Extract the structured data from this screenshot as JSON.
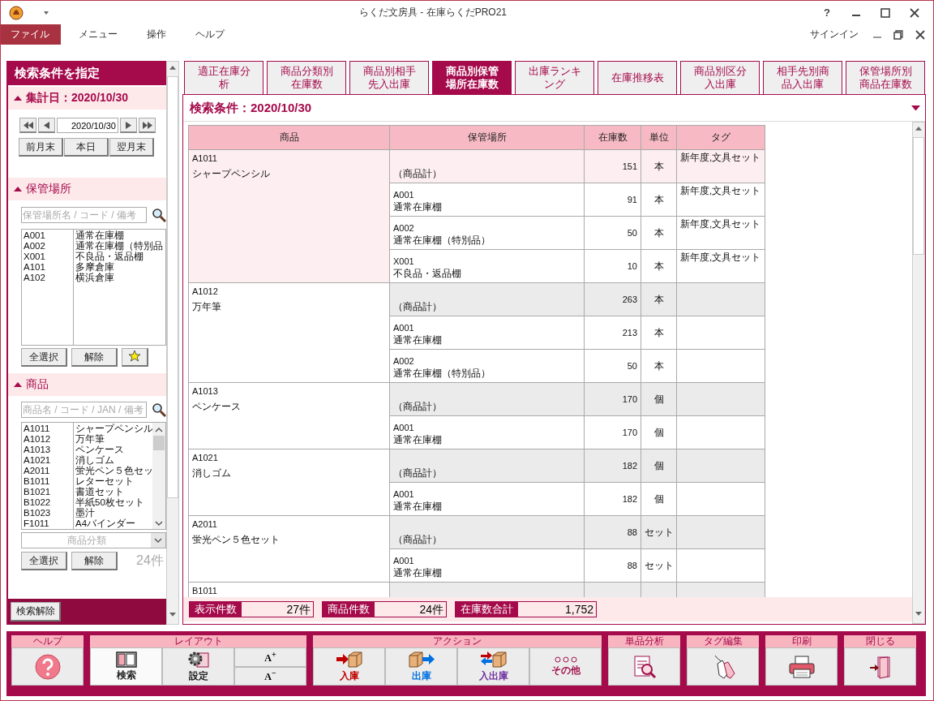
{
  "window": {
    "title": "らくだ文房具 - 在庫らくだPRO21",
    "help": "?"
  },
  "menu": {
    "items": [
      {
        "label": "ファイル",
        "selected": true
      },
      {
        "label": "メニュー",
        "selected": false
      },
      {
        "label": "操作",
        "selected": false
      },
      {
        "label": "ヘルプ",
        "selected": false
      }
    ],
    "signin": "サインイン"
  },
  "search_panel": {
    "title": "検索条件を指定",
    "date_section": {
      "title": "集計日：2020/10/30",
      "expanded": true,
      "date": "2020/10/30",
      "buttons": [
        "前月末",
        "本日",
        "翌月末"
      ]
    },
    "location_section": {
      "title": "保管場所",
      "expanded": true,
      "placeholder": "保管場所名 / コード / 備考",
      "buttons": [
        "全選択",
        "解除"
      ],
      "items": [
        {
          "code": "A001",
          "name": "通常在庫棚"
        },
        {
          "code": "A002",
          "name": "通常在庫棚（特別品"
        },
        {
          "code": "X001",
          "name": "不良品・返品棚"
        },
        {
          "code": "A101",
          "name": "多摩倉庫"
        },
        {
          "code": "A102",
          "name": "横浜倉庫"
        }
      ]
    },
    "product_section": {
      "title": "商品",
      "expanded": true,
      "placeholder": "商品名 / コード / JAN / 備考",
      "category": "商品分類",
      "buttons": [
        "全選択",
        "解除"
      ],
      "count": "24件",
      "items": [
        {
          "code": "A1011",
          "name": "シャープペンシル"
        },
        {
          "code": "A1012",
          "name": "万年筆"
        },
        {
          "code": "A1013",
          "name": "ペンケース"
        },
        {
          "code": "A1021",
          "name": "消しゴム"
        },
        {
          "code": "A2011",
          "name": "蛍光ペン５色セッ"
        },
        {
          "code": "B1011",
          "name": "レターセット"
        },
        {
          "code": "B1021",
          "name": "書道セット"
        },
        {
          "code": "B1022",
          "name": "半紙50枚セット"
        },
        {
          "code": "B1023",
          "name": "墨汁"
        },
        {
          "code": "F1011",
          "name": "A4バインダー"
        }
      ]
    },
    "clear_button": "検索解除"
  },
  "tabs": [
    {
      "label": "適正在庫分析",
      "selected": false
    },
    {
      "label": "商品分類別在庫数",
      "selected": false
    },
    {
      "label": "商品別相手先入出庫",
      "selected": false
    },
    {
      "label": "商品別保管場所在庫数",
      "selected": true
    },
    {
      "label": "出庫ランキング",
      "selected": false
    },
    {
      "label": "在庫推移表",
      "selected": false
    },
    {
      "label": "商品別区分入出庫",
      "selected": false
    },
    {
      "label": "相手先別商品入出庫",
      "selected": false
    },
    {
      "label": "保管場所別商品在庫数",
      "selected": false
    }
  ],
  "condition": "検索条件：2020/10/30",
  "table": {
    "columns": [
      "商品",
      "保管場所",
      "在庫数",
      "単位",
      "タグ"
    ],
    "groups": [
      {
        "code": "A1011",
        "name": "シャープペンシル",
        "selected": true,
        "rows": [
          {
            "kind": "subtotal",
            "location_name": "（商品計）",
            "qty": "151",
            "unit": "本",
            "tag": "新年度,文具セット"
          },
          {
            "kind": "detail",
            "location_code": "A001",
            "location_name": "通常在庫棚",
            "qty": "91",
            "unit": "本",
            "tag": "新年度,文具セット"
          },
          {
            "kind": "detail",
            "location_code": "A002",
            "location_name": "通常在庫棚（特別品）",
            "qty": "50",
            "unit": "本",
            "tag": "新年度,文具セット"
          },
          {
            "kind": "detail",
            "location_code": "X001",
            "location_name": "不良品・返品棚",
            "qty": "10",
            "unit": "本",
            "tag": "新年度,文具セット"
          }
        ]
      },
      {
        "code": "A1012",
        "name": "万年筆",
        "selected": false,
        "rows": [
          {
            "kind": "subtotal",
            "location_name": "（商品計）",
            "qty": "263",
            "unit": "本"
          },
          {
            "kind": "detail",
            "location_code": "A001",
            "location_name": "通常在庫棚",
            "qty": "213",
            "unit": "本"
          },
          {
            "kind": "detail",
            "location_code": "A002",
            "location_name": "通常在庫棚（特別品）",
            "qty": "50",
            "unit": "本"
          }
        ]
      },
      {
        "code": "A1013",
        "name": "ペンケース",
        "selected": false,
        "rows": [
          {
            "kind": "subtotal",
            "location_name": "（商品計）",
            "qty": "170",
            "unit": "個"
          },
          {
            "kind": "detail",
            "location_code": "A001",
            "location_name": "通常在庫棚",
            "qty": "170",
            "unit": "個"
          }
        ]
      },
      {
        "code": "A1021",
        "name": "消しゴム",
        "selected": false,
        "rows": [
          {
            "kind": "subtotal",
            "location_name": "（商品計）",
            "qty": "182",
            "unit": "個"
          },
          {
            "kind": "detail",
            "location_code": "A001",
            "location_name": "通常在庫棚",
            "qty": "182",
            "unit": "個"
          }
        ]
      },
      {
        "code": "A2011",
        "name": "蛍光ペン５色セット",
        "selected": false,
        "rows": [
          {
            "kind": "subtotal",
            "location_name": "（商品計）",
            "qty": "88",
            "unit": "セット"
          },
          {
            "kind": "detail",
            "location_code": "A001",
            "location_name": "通常在庫棚",
            "qty": "88",
            "unit": "セット"
          }
        ]
      },
      {
        "code": "B1011",
        "selected": false
      }
    ]
  },
  "summary": [
    {
      "label": "表示件数",
      "value": "27件"
    },
    {
      "label": "商品件数",
      "value": "24件"
    },
    {
      "label": "在庫数合計",
      "value": "1,752"
    }
  ],
  "toolbar": [
    {
      "label": "ヘルプ",
      "buttons": [
        {
          "kind": "icon",
          "selected": false
        }
      ]
    },
    {
      "label": "レイアウト",
      "buttons": [
        {
          "kind": "icon",
          "label": "検索",
          "selected": true
        },
        {
          "kind": "icon",
          "label": "設定",
          "selected": false
        },
        {
          "kind": "font",
          "labels": [
            "A$^{+}$",
            "A$^{−}$"
          ]
        }
      ]
    },
    {
      "label": "アクション",
      "buttons": [
        {
          "kind": "icon",
          "label": "入庫",
          "color": "#c00000",
          "selected": false
        },
        {
          "kind": "icon",
          "label": "出庫",
          "color": "#0070e0",
          "selected": false
        },
        {
          "kind": "icon",
          "label": "入出庫",
          "color": "#7030a0",
          "selected": false
        },
        {
          "kind": "icon",
          "label": "その他",
          "color": "#a0104c",
          "selected": false
        }
      ]
    },
    {
      "label": "単品分析",
      "buttons": [
        {
          "kind": "icon",
          "selected": false
        }
      ]
    },
    {
      "label": "タグ編集",
      "buttons": [
        {
          "kind": "icon",
          "selected": false
        }
      ]
    },
    {
      "label": "印刷",
      "buttons": [
        {
          "kind": "icon",
          "selected": false
        }
      ]
    },
    {
      "label": "閉じる",
      "buttons": [
        {
          "kind": "icon",
          "selected": false
        }
      ]
    }
  ]
}
